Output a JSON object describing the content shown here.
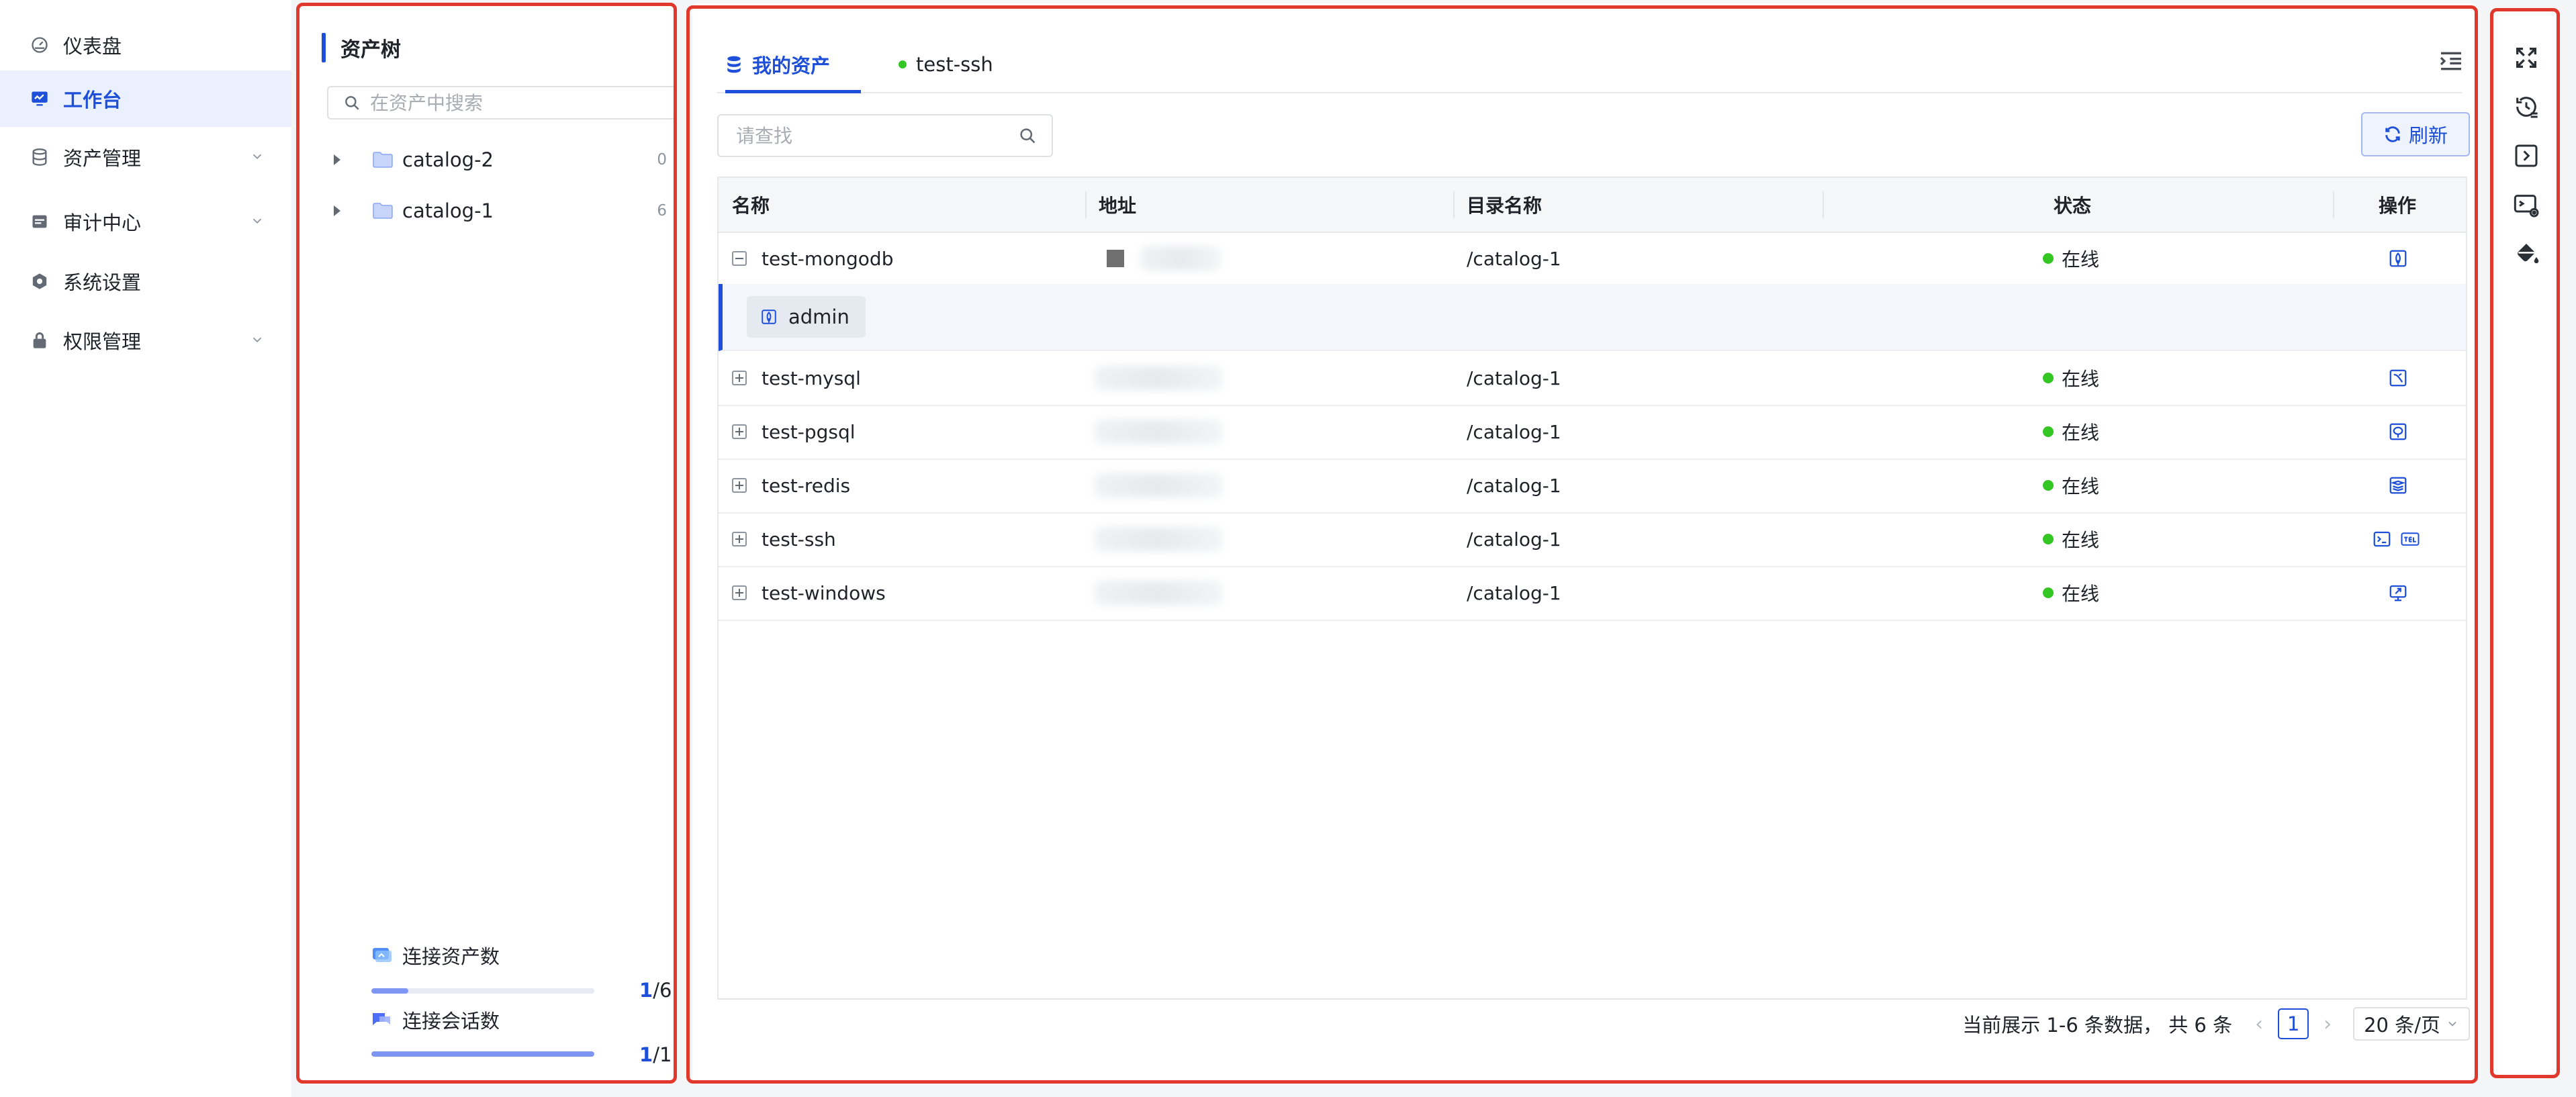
{
  "nav": {
    "items": [
      {
        "label": "仪表盘",
        "icon": "dashboard-icon",
        "active": false,
        "has_children": false
      },
      {
        "label": "工作台",
        "icon": "workbench-icon",
        "active": true,
        "has_children": false
      },
      {
        "label": "资产管理",
        "icon": "database-icon",
        "active": false,
        "has_children": true
      },
      {
        "label": "审计中心",
        "icon": "audit-icon",
        "active": false,
        "has_children": true
      },
      {
        "label": "系统设置",
        "icon": "settings-icon",
        "active": false,
        "has_children": false
      },
      {
        "label": "权限管理",
        "icon": "lock-icon",
        "active": false,
        "has_children": true
      }
    ]
  },
  "tree": {
    "title": "资产树",
    "search_placeholder": "在资产中搜索",
    "nodes": [
      {
        "label": "catalog-2",
        "count": "0"
      },
      {
        "label": "catalog-1",
        "count": "6"
      }
    ],
    "stats": [
      {
        "label": "连接资产数",
        "current": "1",
        "total": "/6",
        "fraction": 0.167
      },
      {
        "label": "连接会话数",
        "current": "1",
        "total": "/1",
        "fraction": 1.0
      }
    ]
  },
  "main": {
    "tabs": [
      {
        "label": "我的资产",
        "active": true
      },
      {
        "label": "test-ssh",
        "active": false,
        "online": true
      }
    ],
    "search_placeholder": "请查找",
    "refresh_label": "刷新",
    "columns": [
      "名称",
      "地址",
      "目录名称",
      "状态",
      "操作"
    ],
    "rows": [
      {
        "name": "test-mongodb",
        "catalog": "/catalog-1",
        "status": "在线",
        "expanded": true,
        "ops": [
          "mongodb-icon"
        ]
      },
      {
        "name": "test-mysql",
        "catalog": "/catalog-1",
        "status": "在线",
        "expanded": false,
        "ops": [
          "mysql-icon"
        ]
      },
      {
        "name": "test-pgsql",
        "catalog": "/catalog-1",
        "status": "在线",
        "expanded": false,
        "ops": [
          "postgresql-icon"
        ]
      },
      {
        "name": "test-redis",
        "catalog": "/catalog-1",
        "status": "在线",
        "expanded": false,
        "ops": [
          "redis-icon"
        ]
      },
      {
        "name": "test-ssh",
        "catalog": "/catalog-1",
        "status": "在线",
        "expanded": false,
        "ops": [
          "terminal-icon",
          "telnet-icon"
        ]
      },
      {
        "name": "test-windows",
        "catalog": "/catalog-1",
        "status": "在线",
        "expanded": false,
        "ops": [
          "rdp-icon"
        ]
      }
    ],
    "sub_account": "admin",
    "pagination": {
      "summary": "当前展示 1-6 条数据，  共 6 条",
      "page": "1",
      "page_size": "20 条/页"
    }
  },
  "colors": {
    "accent": "#1d4fd8",
    "online": "#34c724",
    "highlight_border": "#e0382a"
  }
}
